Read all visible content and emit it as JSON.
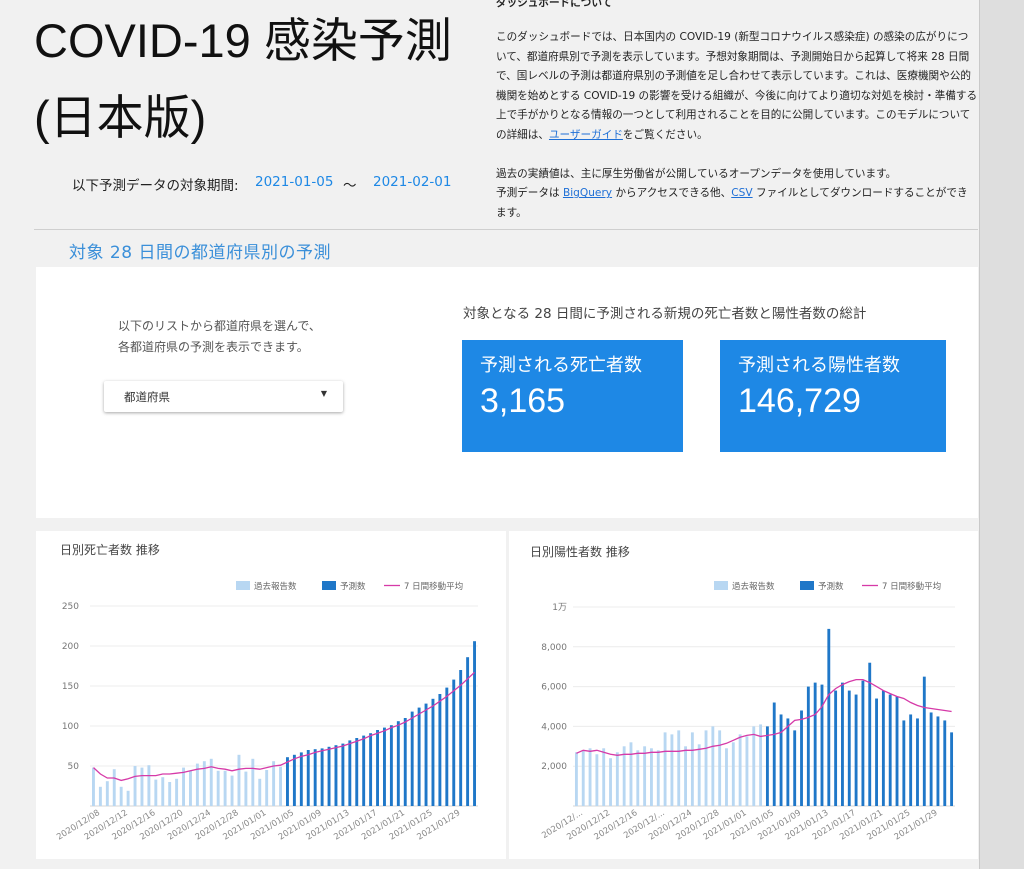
{
  "header": {
    "title_line1": "COVID-19 感染予測",
    "title_line2": "(日本版)",
    "period_label": "以下予測データの対象期間:",
    "period_start": "2021-01-05",
    "period_sep": "〜",
    "period_end": "2021-02-01"
  },
  "about": {
    "title": "ダッシュボードについて",
    "p1_a": "このダッシュボードでは、日本国内の COVID-19 (新型コロナウイルス感染症) の感染の広がりについて、都道府県別で予測を表示しています。予想対象期間は、予測開始日から起算して将来 28 日間で、国レベルの予測は都道府県別の予測値を足し合わせて表示しています。これは、医療機関や公的機関を始めとする COVID-19 の影響を受ける組織が、今後に向けてより適切な対処を検討・準備する上で手がかりとなる情報の一つとして利用されることを目的に公開しています。このモデルについての詳細は、",
    "p1_link": "ユーザーガイド",
    "p1_b": "をご覧ください。",
    "p2_a": "過去の実績値は、主に厚生労働省が公開しているオープンデータを使用しています。",
    "p2_b": "予測データは ",
    "p2_link1": "BigQuery",
    "p2_c": " からアクセスできる他、",
    "p2_link2": "CSV",
    "p2_d": " ファイルとしてダウンロードすることができます。"
  },
  "section": {
    "title": "対象 28 日間の都道府県別の予測"
  },
  "selector": {
    "instruction_line1": "以下のリストから都道府県を選んで、",
    "instruction_line2": "各都道府県の予測を表示できます。",
    "dropdown_label": "都道府県"
  },
  "totals": {
    "title": "対象となる 28 日間に予測される新規の死亡者数と陽性者数の総計",
    "deaths_label": "予測される死亡者数",
    "deaths_value": "3,165",
    "cases_label": "予測される陽性者数",
    "cases_value": "146,729"
  },
  "colors": {
    "accent": "#1e88e5",
    "past_bar": "#b8d7f2",
    "forecast_bar": "#1f77c8",
    "moving_avg": "#d63aa8"
  },
  "chart_data": [
    {
      "type": "bar",
      "title": "日別死亡者数 推移",
      "legend": [
        "過去報告数",
        "予測数",
        "7 日間移動平均"
      ],
      "legend_position": "top-right",
      "ylim": [
        0,
        250
      ],
      "yticks": [
        "50",
        "100",
        "150",
        "200",
        "250"
      ],
      "ytick_values": [
        50,
        100,
        150,
        200,
        250
      ],
      "x_labels": [
        "2020/12/08",
        "2020/12/12",
        "2020/12/16",
        "2020/12/20",
        "2020/12/24",
        "2020/12/28",
        "2021/01/01",
        "2021/01/05",
        "2021/01/09",
        "2021/01/13",
        "2021/01/17",
        "2021/01/21",
        "2021/01/25",
        "2021/01/29"
      ],
      "dates_start": "2020/12/08",
      "past": [
        48,
        24,
        31,
        46,
        24,
        19,
        50,
        48,
        51,
        33,
        36,
        30,
        34,
        48,
        44,
        53,
        56,
        59,
        44,
        44,
        38,
        64,
        43,
        59,
        34,
        45,
        56,
        49
      ],
      "forecast": [
        61,
        64,
        67,
        70,
        71,
        72,
        74,
        76,
        78,
        82,
        85,
        88,
        91,
        95,
        98,
        101,
        106,
        110,
        118,
        123,
        128,
        134,
        140,
        148,
        158,
        170,
        186,
        206
      ],
      "moving_average": [
        48,
        40,
        35,
        35,
        32,
        34,
        37,
        38,
        38,
        38,
        40,
        40,
        41,
        42,
        44,
        46,
        47,
        49,
        47,
        46,
        44,
        46,
        47,
        47,
        46,
        48,
        50,
        51,
        55,
        59,
        62,
        64,
        67,
        69,
        71,
        73,
        75,
        78,
        81,
        84,
        88,
        91,
        94,
        98,
        101,
        105,
        110,
        115,
        120,
        125,
        131,
        137,
        144,
        151,
        159,
        167
      ]
    },
    {
      "type": "bar",
      "title": "日別陽性者数 推移",
      "legend": [
        "過去報告数",
        "予測数",
        "7 日間移動平均"
      ],
      "legend_position": "top-right",
      "ylim": [
        0,
        10000
      ],
      "yticks": [
        "2,000",
        "4,000",
        "6,000",
        "8,000",
        "1万"
      ],
      "ytick_values": [
        2000,
        4000,
        6000,
        8000,
        10000
      ],
      "x_labels": [
        "2020/12/...",
        "2020/12/12",
        "2020/12/16",
        "2020/12/...",
        "2020/12/24",
        "2020/12/28",
        "2021/01/01",
        "2021/01/05",
        "2021/01/09",
        "2021/01/13",
        "2021/01/17",
        "2021/01/21",
        "2021/01/25",
        "2021/01/29"
      ],
      "dates_start": "2020/12/08",
      "past": [
        2700,
        2800,
        2900,
        2600,
        2900,
        2400,
        2700,
        3000,
        3200,
        2800,
        3000,
        2900,
        2800,
        3700,
        3600,
        3800,
        3000,
        3700,
        3100,
        3800,
        4000,
        3800,
        2900,
        3200,
        3600,
        3500,
        4000,
        4100
      ],
      "forecast": [
        4000,
        5200,
        4600,
        4400,
        3800,
        4800,
        6000,
        6200,
        6100,
        8900,
        5800,
        6200,
        5800,
        5600,
        6300,
        7200,
        5400,
        5800,
        5600,
        5500,
        4300,
        4600,
        4400,
        6500,
        4700,
        4500,
        4300,
        3700
      ],
      "moving_average": [
        2650,
        2800,
        2750,
        2800,
        2700,
        2600,
        2550,
        2600,
        2600,
        2650,
        2650,
        2700,
        2700,
        2750,
        2750,
        2750,
        2800,
        2800,
        2850,
        2900,
        3000,
        3050,
        3150,
        3300,
        3450,
        3550,
        3600,
        3500,
        3550,
        3600,
        3700,
        4000,
        4300,
        4350,
        4450,
        4600,
        5000,
        5600,
        5900,
        6100,
        6250,
        6350,
        6350,
        6200,
        6000,
        5800,
        5650,
        5500,
        5400,
        5200,
        5050,
        4950,
        4900,
        4850,
        4800,
        4750
      ]
    }
  ]
}
